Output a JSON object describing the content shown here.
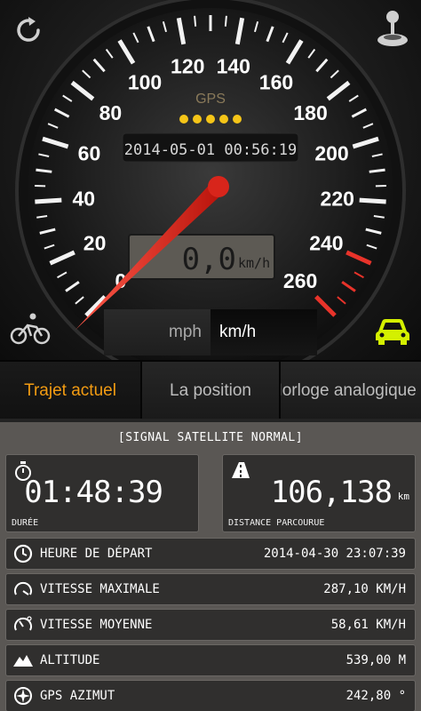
{
  "gauge": {
    "min": 0,
    "max": 260,
    "ticks": [
      "0",
      "20",
      "40",
      "60",
      "80",
      "100",
      "120",
      "140",
      "160",
      "180",
      "200",
      "220",
      "240",
      "260"
    ],
    "current_speed": 0.0,
    "gps_label": "GPS",
    "gps_dots": 5,
    "datetime": "2014-05-01 00:56:19",
    "speed_display": "0,0",
    "speed_unit": "km/h",
    "accent_color": "#e8332a",
    "gps_dot_color": "#f5c518"
  },
  "units": {
    "mph": "mph",
    "kmh": "km/h"
  },
  "tabs": [
    {
      "label": "Trajet actuel",
      "active": true
    },
    {
      "label": "La position",
      "active": false
    },
    {
      "label": "Horloge analogique",
      "active": false
    }
  ],
  "panel": {
    "signal": "[SIGNAL SATELLITE NORMAL]",
    "duration": {
      "value": "01:48:39",
      "label": "DURÉE",
      "icon": "stopwatch-icon"
    },
    "distance": {
      "value": "106,138",
      "unit": "km",
      "label": "DISTANCE PARCOURUE",
      "icon": "road-icon"
    },
    "rows": [
      {
        "name": "HEURE DE DÉPART",
        "value": "2014-04-30 23:07:39",
        "icon": "clock-icon"
      },
      {
        "name": "VITESSE MAXIMALE",
        "value": "287,10 KM/H",
        "icon": "speedometer-icon"
      },
      {
        "name": "VITESSE MOYENNE",
        "value": "58,61 KM/H",
        "icon": "average-speed-icon"
      },
      {
        "name": "ALTITUDE",
        "value": "539,00 M",
        "icon": "mountain-icon"
      },
      {
        "name": "GPS AZIMUT",
        "value": "242,80 °",
        "icon": "compass-icon"
      }
    ]
  },
  "colors": {
    "active_tab": "#f39c12",
    "car_mode": "#d4f000"
  }
}
